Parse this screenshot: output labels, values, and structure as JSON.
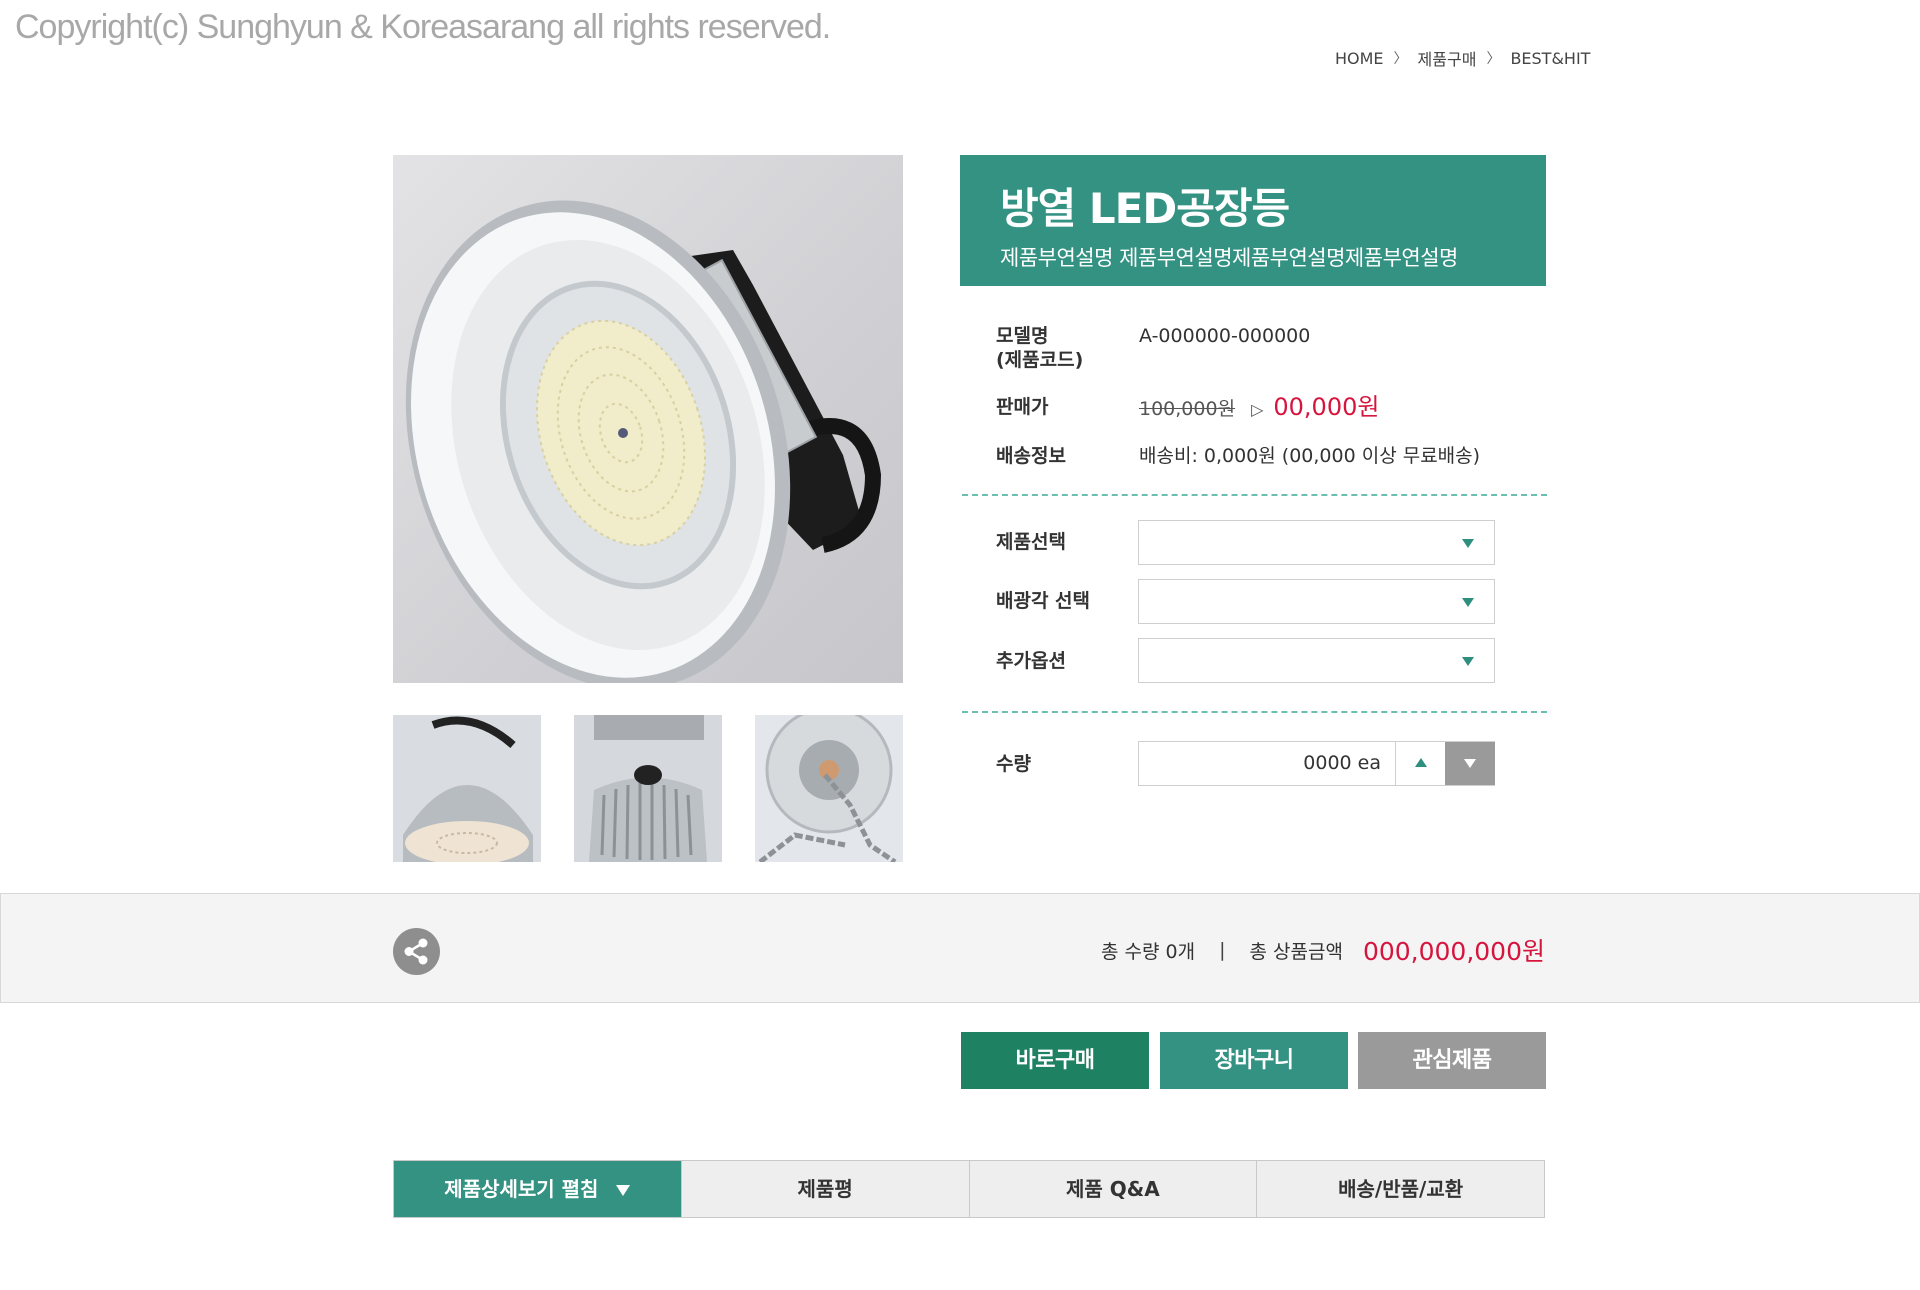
{
  "copyright": "Copyright(c) Sunghyun & Koreasarang all rights reserved.",
  "breadcrumb": {
    "items": [
      "HOME",
      "제품구매",
      "BEST&HIT"
    ],
    "separator": "〉"
  },
  "product": {
    "title": "방열 LED공장등",
    "subtitle": "제품부연설명 제품부연설명제품부연설명제품부연설명",
    "model_label_1": "모델명",
    "model_label_2": "(제품코드)",
    "model_value": "A-000000-000000",
    "price_label": "판매가",
    "old_price": "100,000원",
    "price_arrow": "▷",
    "new_price": "00,000원",
    "shipping_label": "배송정보",
    "shipping_value": "배송비: 0,000원 (00,000 이상 무료배송)"
  },
  "options": {
    "product_select_label": "제품선택",
    "beam_angle_label": "배광각 선택",
    "extra_option_label": "추가옵션",
    "quantity_label": "수량",
    "quantity_value": "0000 ea"
  },
  "summary": {
    "total_qty": "총 수량 0개",
    "separator": "|",
    "total_amount_label": "총 상품금액",
    "total_amount": "000,000,000원"
  },
  "buttons": {
    "buy_now": "바로구매",
    "cart": "장바구니",
    "wishlist": "관심제품"
  },
  "tabs": [
    {
      "label": "제품상세보기 펼침"
    },
    {
      "label": "제품평"
    },
    {
      "label": "제품 Q&A"
    },
    {
      "label": "배송/반품/교환"
    }
  ],
  "colors": {
    "brand": "#349282",
    "buy_button": "#1e8161",
    "price_red": "#d6153e",
    "gray_button": "#9a9a9a"
  },
  "icons": {
    "share": "share-icon",
    "select_arrow": "chevron-down-icon",
    "qty_up": "triangle-up-icon",
    "qty_down": "triangle-down-icon"
  }
}
